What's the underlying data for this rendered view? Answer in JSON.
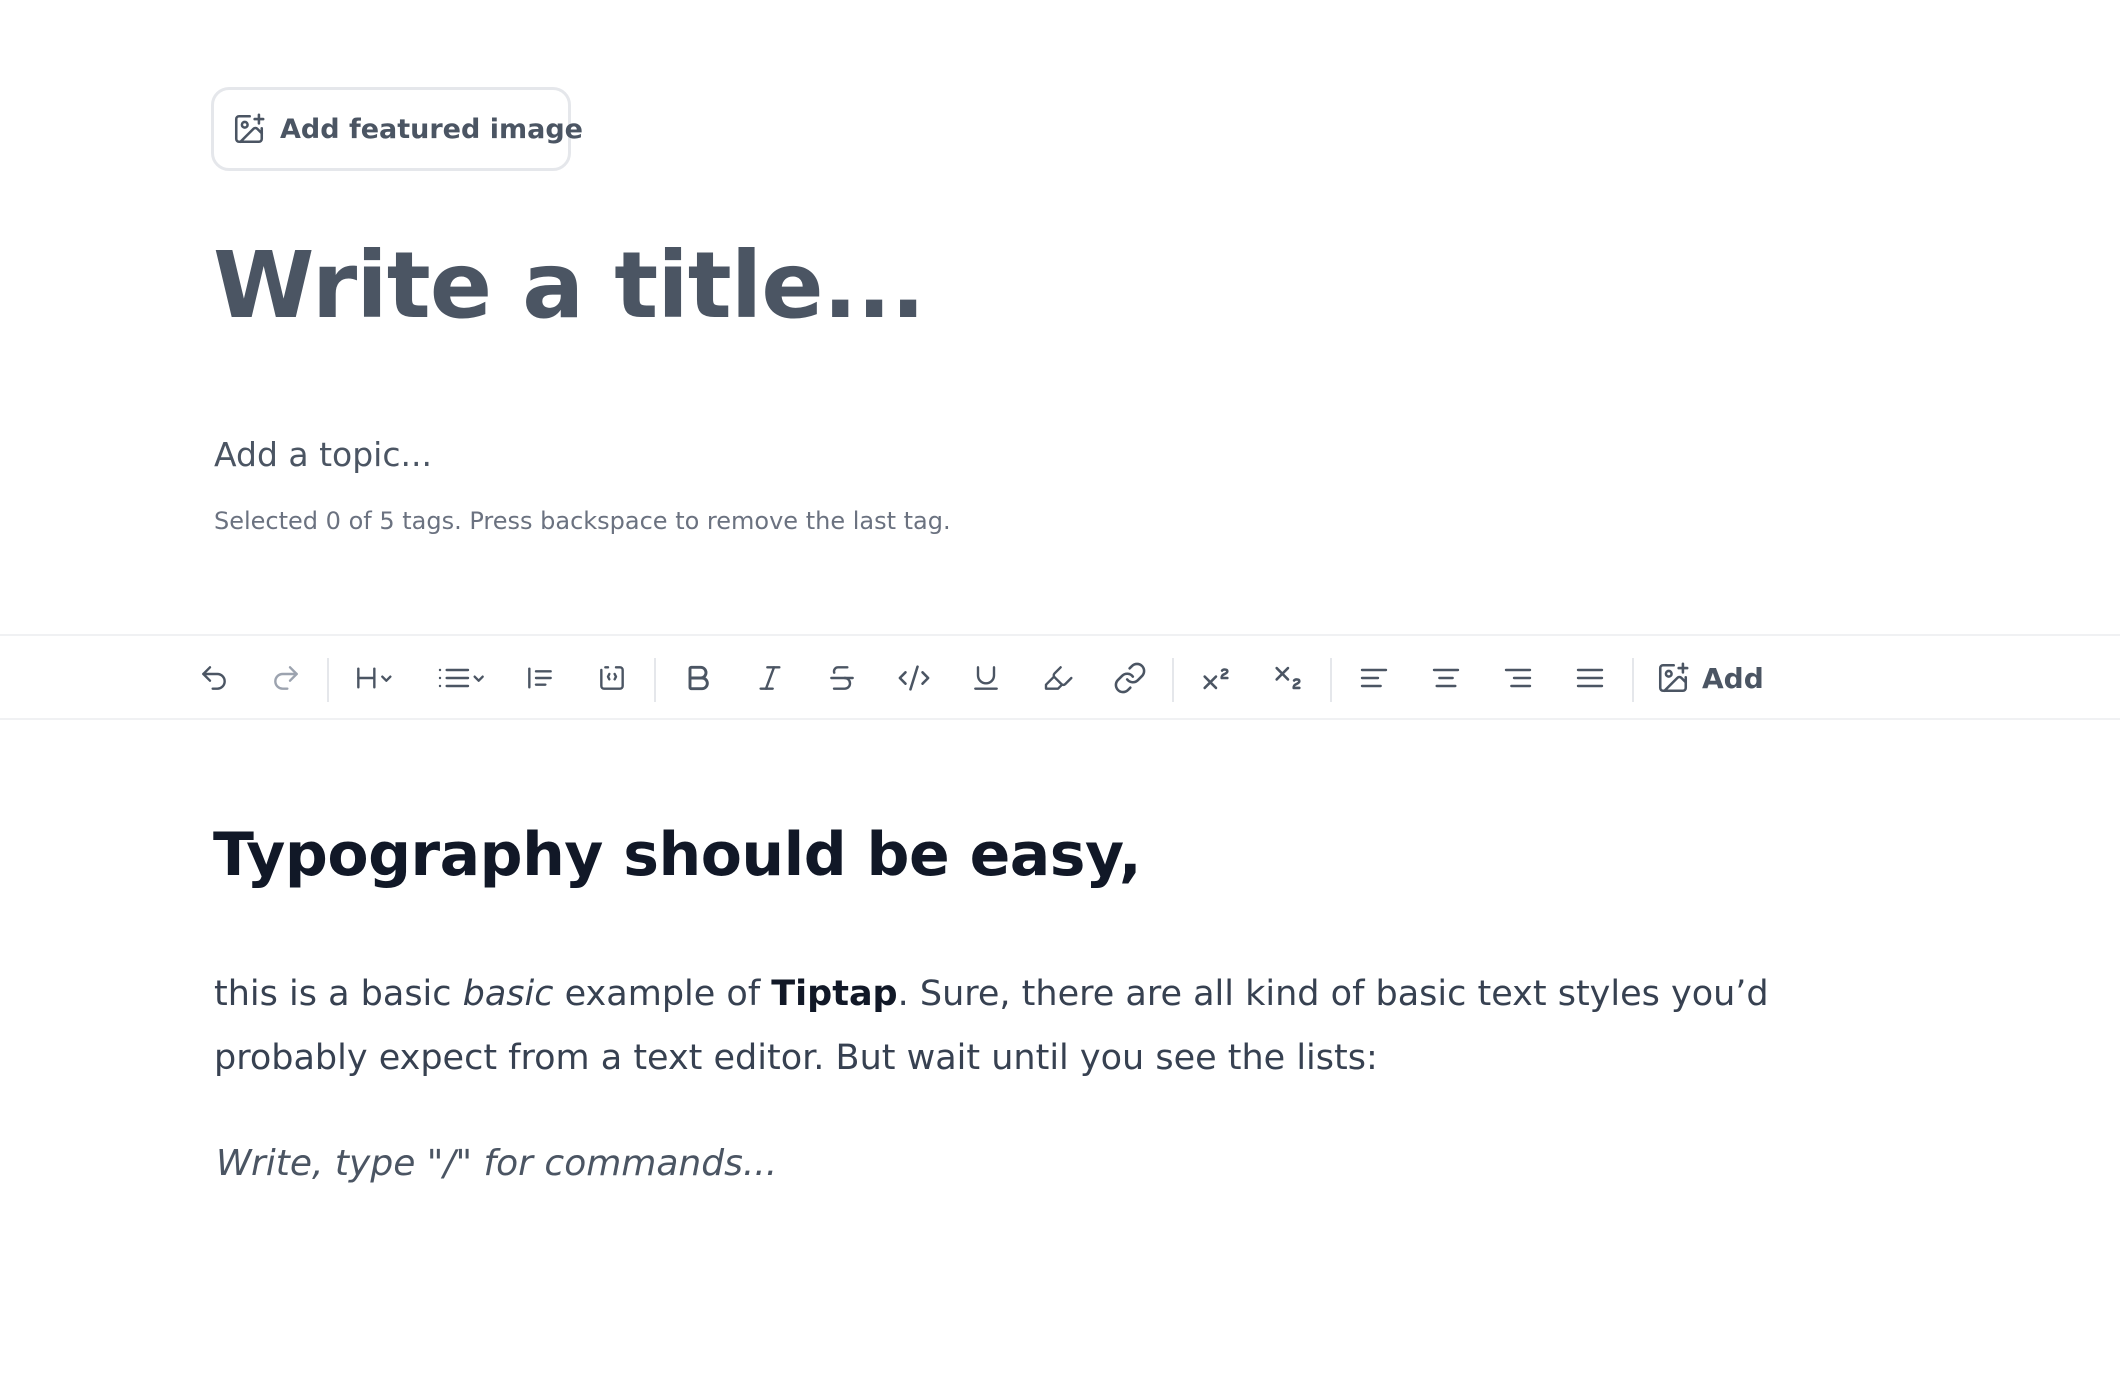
{
  "featured_image": {
    "label": "Add featured image",
    "icon": "image-plus-icon"
  },
  "title": {
    "placeholder": "Write a title..."
  },
  "topic": {
    "placeholder": "Add a topic...",
    "hint": "Selected 0 of 5 tags. Press backspace to remove the last tag."
  },
  "toolbar": {
    "items": [
      {
        "name": "undo",
        "icon": "undo-icon"
      },
      {
        "name": "redo",
        "icon": "redo-icon"
      },
      {
        "name": "heading",
        "icon": "heading-icon"
      },
      {
        "name": "list",
        "icon": "list-icon"
      },
      {
        "name": "blockquote",
        "icon": "blockquote-icon"
      },
      {
        "name": "code-block",
        "icon": "code-block-icon"
      },
      {
        "name": "bold",
        "icon": "bold-icon"
      },
      {
        "name": "italic",
        "icon": "italic-icon"
      },
      {
        "name": "strike",
        "icon": "strikethrough-icon"
      },
      {
        "name": "code",
        "icon": "code-icon"
      },
      {
        "name": "underline",
        "icon": "underline-icon"
      },
      {
        "name": "highlight",
        "icon": "highlighter-icon"
      },
      {
        "name": "link",
        "icon": "link-icon"
      },
      {
        "name": "superscript",
        "icon": "superscript-icon"
      },
      {
        "name": "subscript",
        "icon": "subscript-icon"
      },
      {
        "name": "align-left",
        "icon": "align-left-icon"
      },
      {
        "name": "align-center",
        "icon": "align-center-icon"
      },
      {
        "name": "align-right",
        "icon": "align-right-icon"
      },
      {
        "name": "align-justify",
        "icon": "align-justify-icon"
      }
    ],
    "add_label": "Add"
  },
  "content": {
    "heading": "Typography should be easy,",
    "paragraph": {
      "part1": "this is a basic ",
      "italic": "basic",
      "part2": " example of ",
      "bold": "Tiptap",
      "part3": ". Sure, there are all kind of basic text styles you’d probably expect from a text editor. But wait until you see the lists:"
    },
    "placeholder": "Write, type \"/\" for commands..."
  },
  "colors": {
    "text_muted": "#4b5563",
    "text_dark": "#111827",
    "border": "#e5e7eb"
  }
}
